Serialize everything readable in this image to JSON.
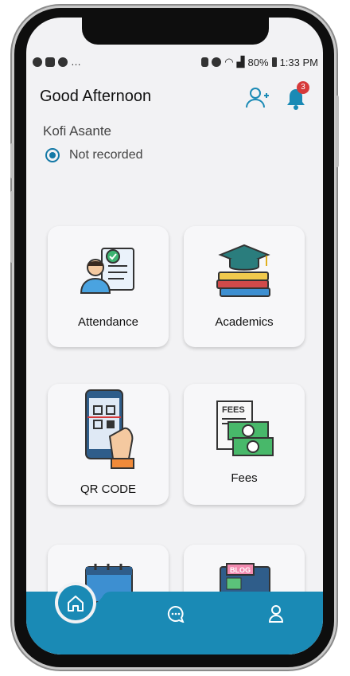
{
  "status_bar": {
    "battery": "80%",
    "time": "1:33 PM"
  },
  "header": {
    "greeting": "Good Afternoon",
    "notification_count": "3"
  },
  "user": {
    "name": "Kofi Asante",
    "status": "Not recorded"
  },
  "tiles": [
    {
      "label": "Attendance",
      "icon": "attendance-icon"
    },
    {
      "label": "Academics",
      "icon": "academics-icon"
    },
    {
      "label": "QR CODE",
      "icon": "qr-code-icon"
    },
    {
      "label": "Fees",
      "icon": "fees-icon"
    },
    {
      "label": "",
      "icon": "calendar-icon"
    },
    {
      "label": "",
      "icon": "blog-icon"
    }
  ],
  "colors": {
    "accent": "#1a8ab5",
    "background": "#f2f2f4",
    "badge": "#d63a3a"
  },
  "bottom_nav": [
    "home-icon",
    "chat-icon",
    "profile-icon"
  ]
}
